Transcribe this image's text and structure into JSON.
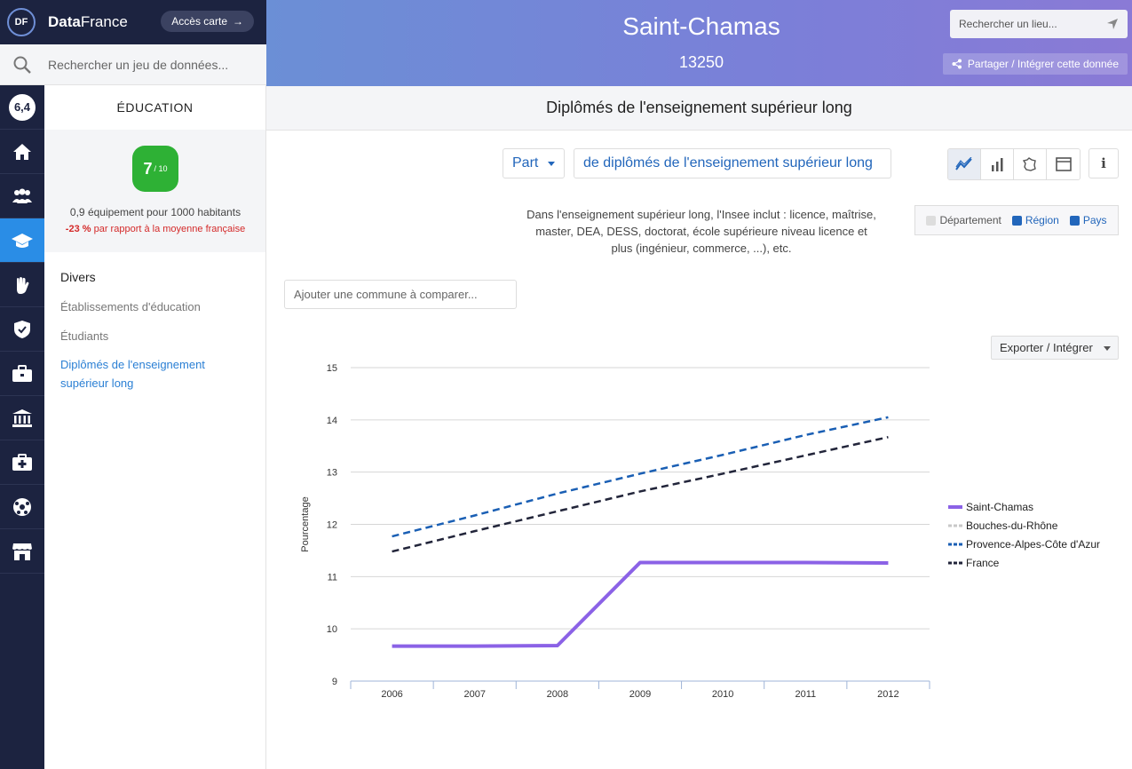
{
  "brand": {
    "logo": "DF",
    "name_bold": "Data",
    "name_rest": "France",
    "map_button": "Accès carte",
    "map_arrow": "→"
  },
  "dataset_search": {
    "placeholder": "Rechercher un jeu de données...",
    "icon": "search-icon"
  },
  "header": {
    "title": "Saint-Chamas",
    "code": "13250",
    "place_search_placeholder": "Rechercher un lieu...",
    "share_label": "Partager / Intégrer cette donnée"
  },
  "icon_nav": {
    "score": "6,4",
    "items": [
      "home-icon",
      "population-icon",
      "education-icon",
      "vote-icon",
      "security-icon",
      "employment-icon",
      "institutions-icon",
      "health-icon",
      "sports-icon",
      "shops-icon"
    ],
    "active": "education-icon"
  },
  "panel": {
    "category": "ÉDUCATION",
    "score": "7",
    "score_max": "/ 10",
    "stat_line1": "0,9 équipement pour 1000 habitants",
    "stat_line2_bold": "-23 %",
    "stat_line2_rest": " par rapport à la moyenne française",
    "section": "Divers",
    "links": [
      "Établissements d'éducation",
      "Étudiants",
      "Diplômés de l'enseignement supérieur long"
    ]
  },
  "main": {
    "subtitle": "Diplômés de l'enseignement supérieur long",
    "mode_select": "Part",
    "measure_select": "de diplômés de l'enseignement supérieur long",
    "info_label": "i",
    "description": "Dans l'enseignement supérieur long, l'Insee inclut : licence, maîtrise, master, DEA, DESS, doctorat, école supérieure niveau licence et plus (ingénieur, commerce, ...), etc.",
    "levels": [
      {
        "label": "Département",
        "checked": false
      },
      {
        "label": "Région",
        "checked": true
      },
      {
        "label": "Pays",
        "checked": true
      }
    ],
    "compare_placeholder": "Ajouter une commune à comparer...",
    "export_label": "Exporter / Intégrer"
  },
  "chart_data": {
    "type": "line",
    "x": [
      "2006",
      "2007",
      "2008",
      "2009",
      "2010",
      "2011",
      "2012"
    ],
    "ylabel": "Pourcentage",
    "ylim": [
      9,
      15
    ],
    "yticks": [
      9,
      10,
      11,
      12,
      13,
      14,
      15
    ],
    "grid": true,
    "legend_position": "right",
    "series": [
      {
        "name": "Saint-Chamas",
        "values": [
          9.67,
          9.67,
          9.68,
          11.27,
          11.27,
          11.27,
          11.26
        ],
        "color": "#8b62e6",
        "dash": false,
        "visible": true
      },
      {
        "name": "Bouches-du-Rhône",
        "values": [],
        "color": "#c8c8c8",
        "dash": true,
        "visible": false
      },
      {
        "name": "Provence-Alpes-Côte d'Azur",
        "values": [
          11.77,
          12.17,
          12.59,
          12.97,
          13.33,
          13.71,
          14.05
        ],
        "color": "#1a5fb4",
        "dash": true,
        "visible": true
      },
      {
        "name": "France",
        "values": [
          11.48,
          11.87,
          12.25,
          12.63,
          12.97,
          13.32,
          13.67
        ],
        "color": "#22253a",
        "dash": true,
        "visible": true
      }
    ]
  }
}
